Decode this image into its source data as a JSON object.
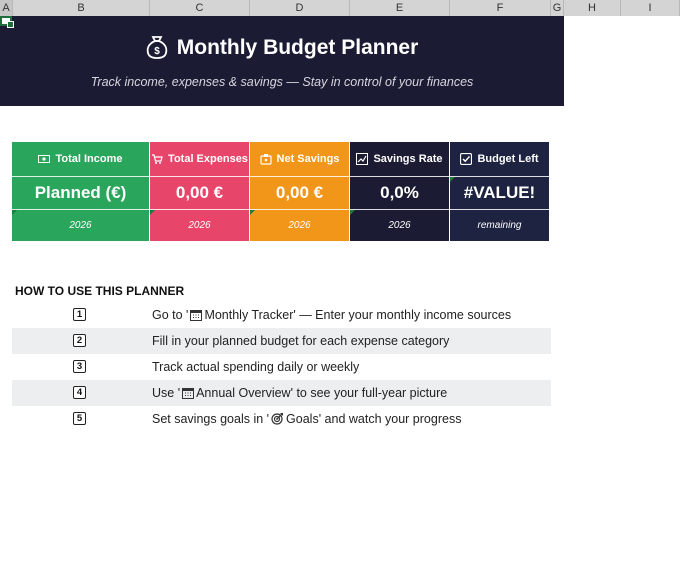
{
  "columns": [
    "A",
    "B",
    "C",
    "D",
    "E",
    "F",
    "G",
    "H",
    "I"
  ],
  "banner": {
    "title": "Monthly Budget Planner",
    "subtitle": "Track income, expenses & savings — Stay in control of your finances"
  },
  "kpis": [
    {
      "label": "Total Income",
      "icon": "money-icon",
      "value": "Planned (€)",
      "footer": "2026",
      "color": "#2aa55c"
    },
    {
      "label": "Total Expenses",
      "icon": "shopping-icon",
      "value": "0,00 €",
      "footer": "2026",
      "color": "#e8456a"
    },
    {
      "label": "Net Savings",
      "icon": "piggy-icon",
      "value": "0,00 €",
      "footer": "2026",
      "color": "#f2961a"
    },
    {
      "label": "Savings Rate",
      "icon": "chart-icon",
      "value": "0,0%",
      "footer": "2026",
      "color": "#1b1c33"
    },
    {
      "label": "Budget Left",
      "icon": "checkbox-icon",
      "value": "#VALUE!",
      "footer": "remaining",
      "color": "#1d2340"
    }
  ],
  "howto": {
    "title": "HOW TO USE THIS PLANNER",
    "steps": [
      {
        "num": "1",
        "pre": "Go to '",
        "sheet": "Monthly Tracker' — Enter your monthly income sources",
        "icon": "calendar-icon"
      },
      {
        "num": "2",
        "pre": "Fill in your planned budget for each expense category",
        "sheet": "",
        "icon": ""
      },
      {
        "num": "3",
        "pre": "Track actual spending daily or weekly",
        "sheet": "",
        "icon": ""
      },
      {
        "num": "4",
        "pre": "Use '",
        "sheet": "Annual Overview' to see your full-year picture",
        "icon": "calendar-icon"
      },
      {
        "num": "5",
        "pre": "Set savings goals in '",
        "sheet": "Goals' and watch your progress",
        "icon": "target-icon"
      }
    ]
  }
}
